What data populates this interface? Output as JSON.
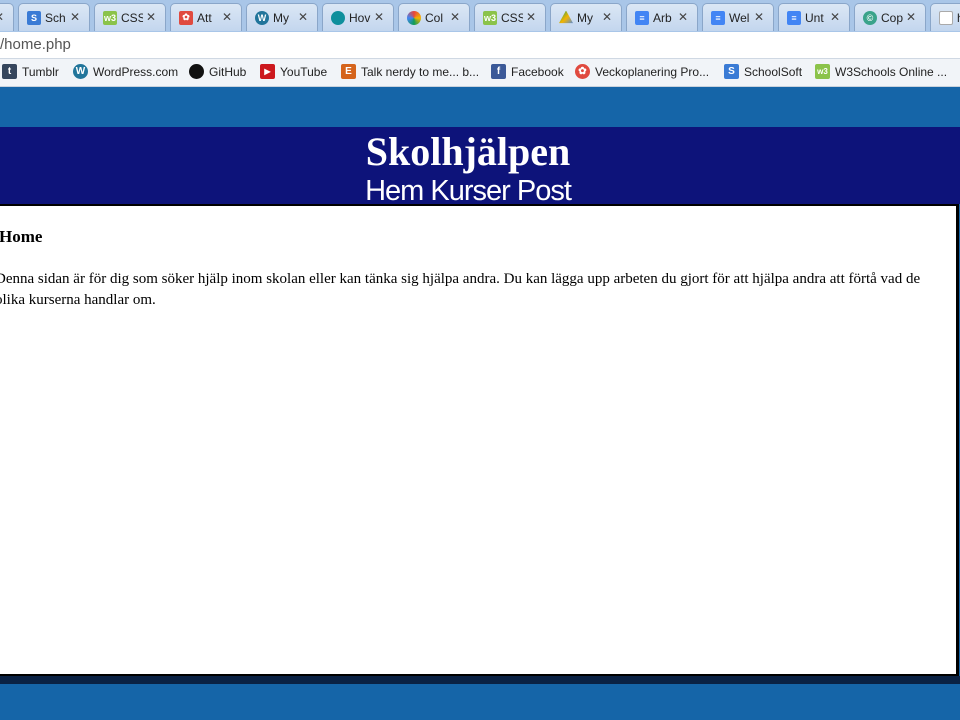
{
  "browser": {
    "tabs": [
      {
        "label": "",
        "icon": "close-icon",
        "color": "#ffffff"
      },
      {
        "label": "Sch",
        "icon": "schoolsoft-icon",
        "color": "#3a7bd5"
      },
      {
        "label": "CSS",
        "icon": "w3schools-icon",
        "color": "#8bc34a"
      },
      {
        "label": "Att",
        "icon": "paw-icon",
        "color": "#e04a3f"
      },
      {
        "label": "My",
        "icon": "wordpress-icon",
        "color": "#21759b"
      },
      {
        "label": "Hov",
        "icon": "globe-icon",
        "color": "#0e8f9c"
      },
      {
        "label": "Col",
        "icon": "color-wheel-icon",
        "color": "#e8453c"
      },
      {
        "label": "CSS",
        "icon": "w3schools-icon",
        "color": "#8bc34a"
      },
      {
        "label": "My",
        "icon": "google-drive-icon",
        "color": "#f4b400"
      },
      {
        "label": "Arb",
        "icon": "google-docs-icon",
        "color": "#4285f4"
      },
      {
        "label": "Wel",
        "icon": "google-docs-icon",
        "color": "#4285f4"
      },
      {
        "label": "Unt",
        "icon": "google-docs-icon",
        "color": "#4285f4"
      },
      {
        "label": "Cop",
        "icon": "copy-icon",
        "color": "#3aa38a"
      },
      {
        "label": "h",
        "icon": "page-icon",
        "color": "#dddddd"
      }
    ],
    "url": "/home.php",
    "bookmarks": [
      {
        "label": "Tumblr",
        "icon": "tumblr-icon",
        "color": "#36465d",
        "glyph": "t"
      },
      {
        "label": "WordPress.com",
        "icon": "wordpress-icon",
        "color": "#21759b",
        "glyph": "W"
      },
      {
        "label": "GitHub",
        "icon": "github-icon",
        "color": "#111111",
        "glyph": "●"
      },
      {
        "label": "YouTube",
        "icon": "youtube-icon",
        "color": "#cc181e",
        "glyph": "▶"
      },
      {
        "label": "Talk nerdy to me... b...",
        "icon": "etsy-icon",
        "color": "#d5641c",
        "glyph": "E"
      },
      {
        "label": "Facebook",
        "icon": "facebook-icon",
        "color": "#3b5998",
        "glyph": "f"
      },
      {
        "label": "Veckoplanering Pro...",
        "icon": "paw-icon",
        "color": "#e04a3f",
        "glyph": "✿"
      },
      {
        "label": "SchoolSoft",
        "icon": "schoolsoft-icon",
        "color": "#3a7bd5",
        "glyph": "S"
      },
      {
        "label": "W3Schools Online ...",
        "icon": "w3schools-icon",
        "color": "#8bc34a",
        "glyph": "w3"
      }
    ]
  },
  "site": {
    "title": "Skolhjälpen",
    "nav": [
      "Hem",
      "Kurser",
      "Post"
    ],
    "content": {
      "heading": "Home",
      "body": "Denna sidan är för dig som söker hjälp inom skolan eller kan tänka sig hjälpa andra. Du kan lägga upp arbeten du gjort för att hjälpa andra att förtå vad de olika kurserna handlar om."
    }
  },
  "colors": {
    "page_background": "#1565a8",
    "header_background": "#0d137a",
    "content_background": "#ffffff"
  }
}
